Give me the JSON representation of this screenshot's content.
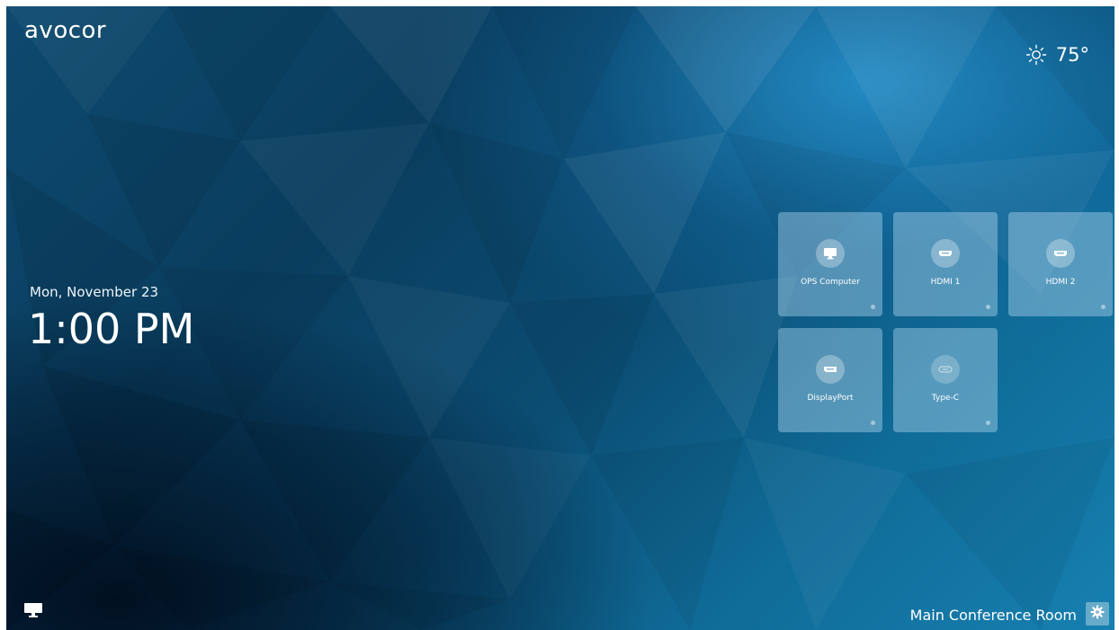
{
  "brand": {
    "logo_text": "avocor"
  },
  "weather": {
    "icon": "sun-icon",
    "temperature": "75°"
  },
  "clock": {
    "date": "Mon, November 23",
    "time": "1:00 PM"
  },
  "sources": [
    {
      "label": "OPS Computer",
      "icon": "monitor-icon"
    },
    {
      "label": "HDMI 1",
      "icon": "hdmi-port-icon"
    },
    {
      "label": "HDMI 2",
      "icon": "hdmi-port-icon"
    },
    {
      "label": "DisplayPort",
      "icon": "displayport-icon"
    },
    {
      "label": "Type-C",
      "icon": "usb-c-icon"
    }
  ],
  "footer": {
    "left_icon": "screen-share-icon",
    "room_name": "Main Conference Room",
    "settings_icon": "gear-icon"
  },
  "colors": {
    "background_dark": "#0a2f48",
    "background_light": "#1780b0",
    "tile": "#bee1f5"
  }
}
